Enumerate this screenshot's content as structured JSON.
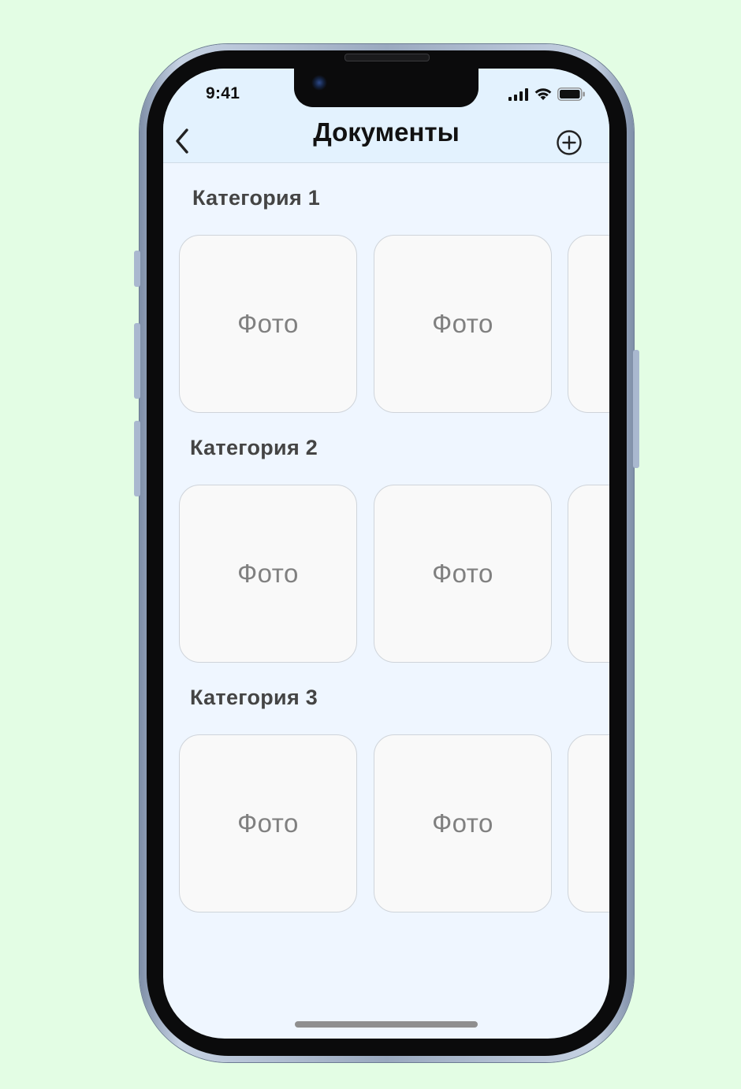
{
  "status_bar": {
    "time": "9:41"
  },
  "header": {
    "title": "Документы"
  },
  "categories": [
    {
      "title": "Категория 1",
      "items": [
        "Фото",
        "Фото",
        ""
      ]
    },
    {
      "title": "Категория 2",
      "items": [
        "Фото",
        "Фото",
        ""
      ]
    },
    {
      "title": "Категория 3",
      "items": [
        "Фото",
        "Фото",
        ""
      ]
    }
  ],
  "icons": {
    "back": "chevron-left-icon",
    "add": "plus-circle-icon",
    "signal": "cellular-signal-icon",
    "wifi": "wifi-icon",
    "battery": "battery-icon"
  },
  "colors": {
    "page_background": "#e3fde4",
    "header_background": "#e3f2fe",
    "screen_background": "#eff6ff",
    "card_background": "#f9f9f9",
    "card_text": "#808080",
    "category_text": "#444444"
  }
}
